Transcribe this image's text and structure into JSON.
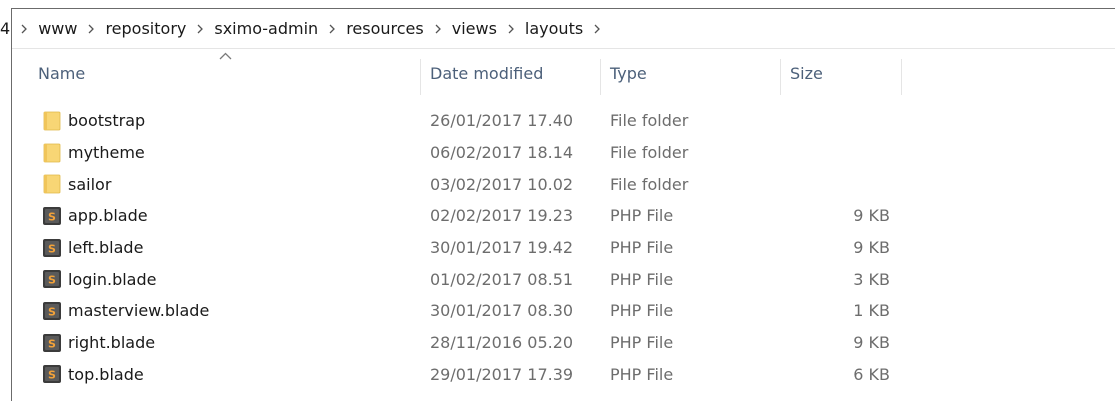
{
  "breadcrumb": {
    "items": [
      "4",
      "www",
      "repository",
      "sximo-admin",
      "resources",
      "views",
      "layouts"
    ]
  },
  "columns": {
    "name": "Name",
    "date": "Date modified",
    "type": "Type",
    "size": "Size"
  },
  "files": [
    {
      "name": "bootstrap",
      "date": "26/01/2017 17.40",
      "type": "File folder",
      "size": "",
      "icon": "folder-icon"
    },
    {
      "name": "mytheme",
      "date": "06/02/2017 18.14",
      "type": "File folder",
      "size": "",
      "icon": "folder-icon"
    },
    {
      "name": "sailor",
      "date": "03/02/2017 10.02",
      "type": "File folder",
      "size": "",
      "icon": "folder-icon"
    },
    {
      "name": "app.blade",
      "date": "02/02/2017 19.23",
      "type": "PHP File",
      "size": "9 KB",
      "icon": "php-file-icon"
    },
    {
      "name": "left.blade",
      "date": "30/01/2017 19.42",
      "type": "PHP File",
      "size": "9 KB",
      "icon": "php-file-icon"
    },
    {
      "name": "login.blade",
      "date": "01/02/2017 08.51",
      "type": "PHP File",
      "size": "3 KB",
      "icon": "php-file-icon"
    },
    {
      "name": "masterview.blade",
      "date": "30/01/2017 08.30",
      "type": "PHP File",
      "size": "1 KB",
      "icon": "php-file-icon"
    },
    {
      "name": "right.blade",
      "date": "28/11/2016 05.20",
      "type": "PHP File",
      "size": "9 KB",
      "icon": "php-file-icon"
    },
    {
      "name": "top.blade",
      "date": "29/01/2017 17.39",
      "type": "PHP File",
      "size": "6 KB",
      "icon": "php-file-icon"
    }
  ],
  "colors": {
    "header_text": "#4c607a",
    "detail_text": "#6d6d6d",
    "folder": "#f8d675",
    "php_icon": "#3b3b3b"
  }
}
